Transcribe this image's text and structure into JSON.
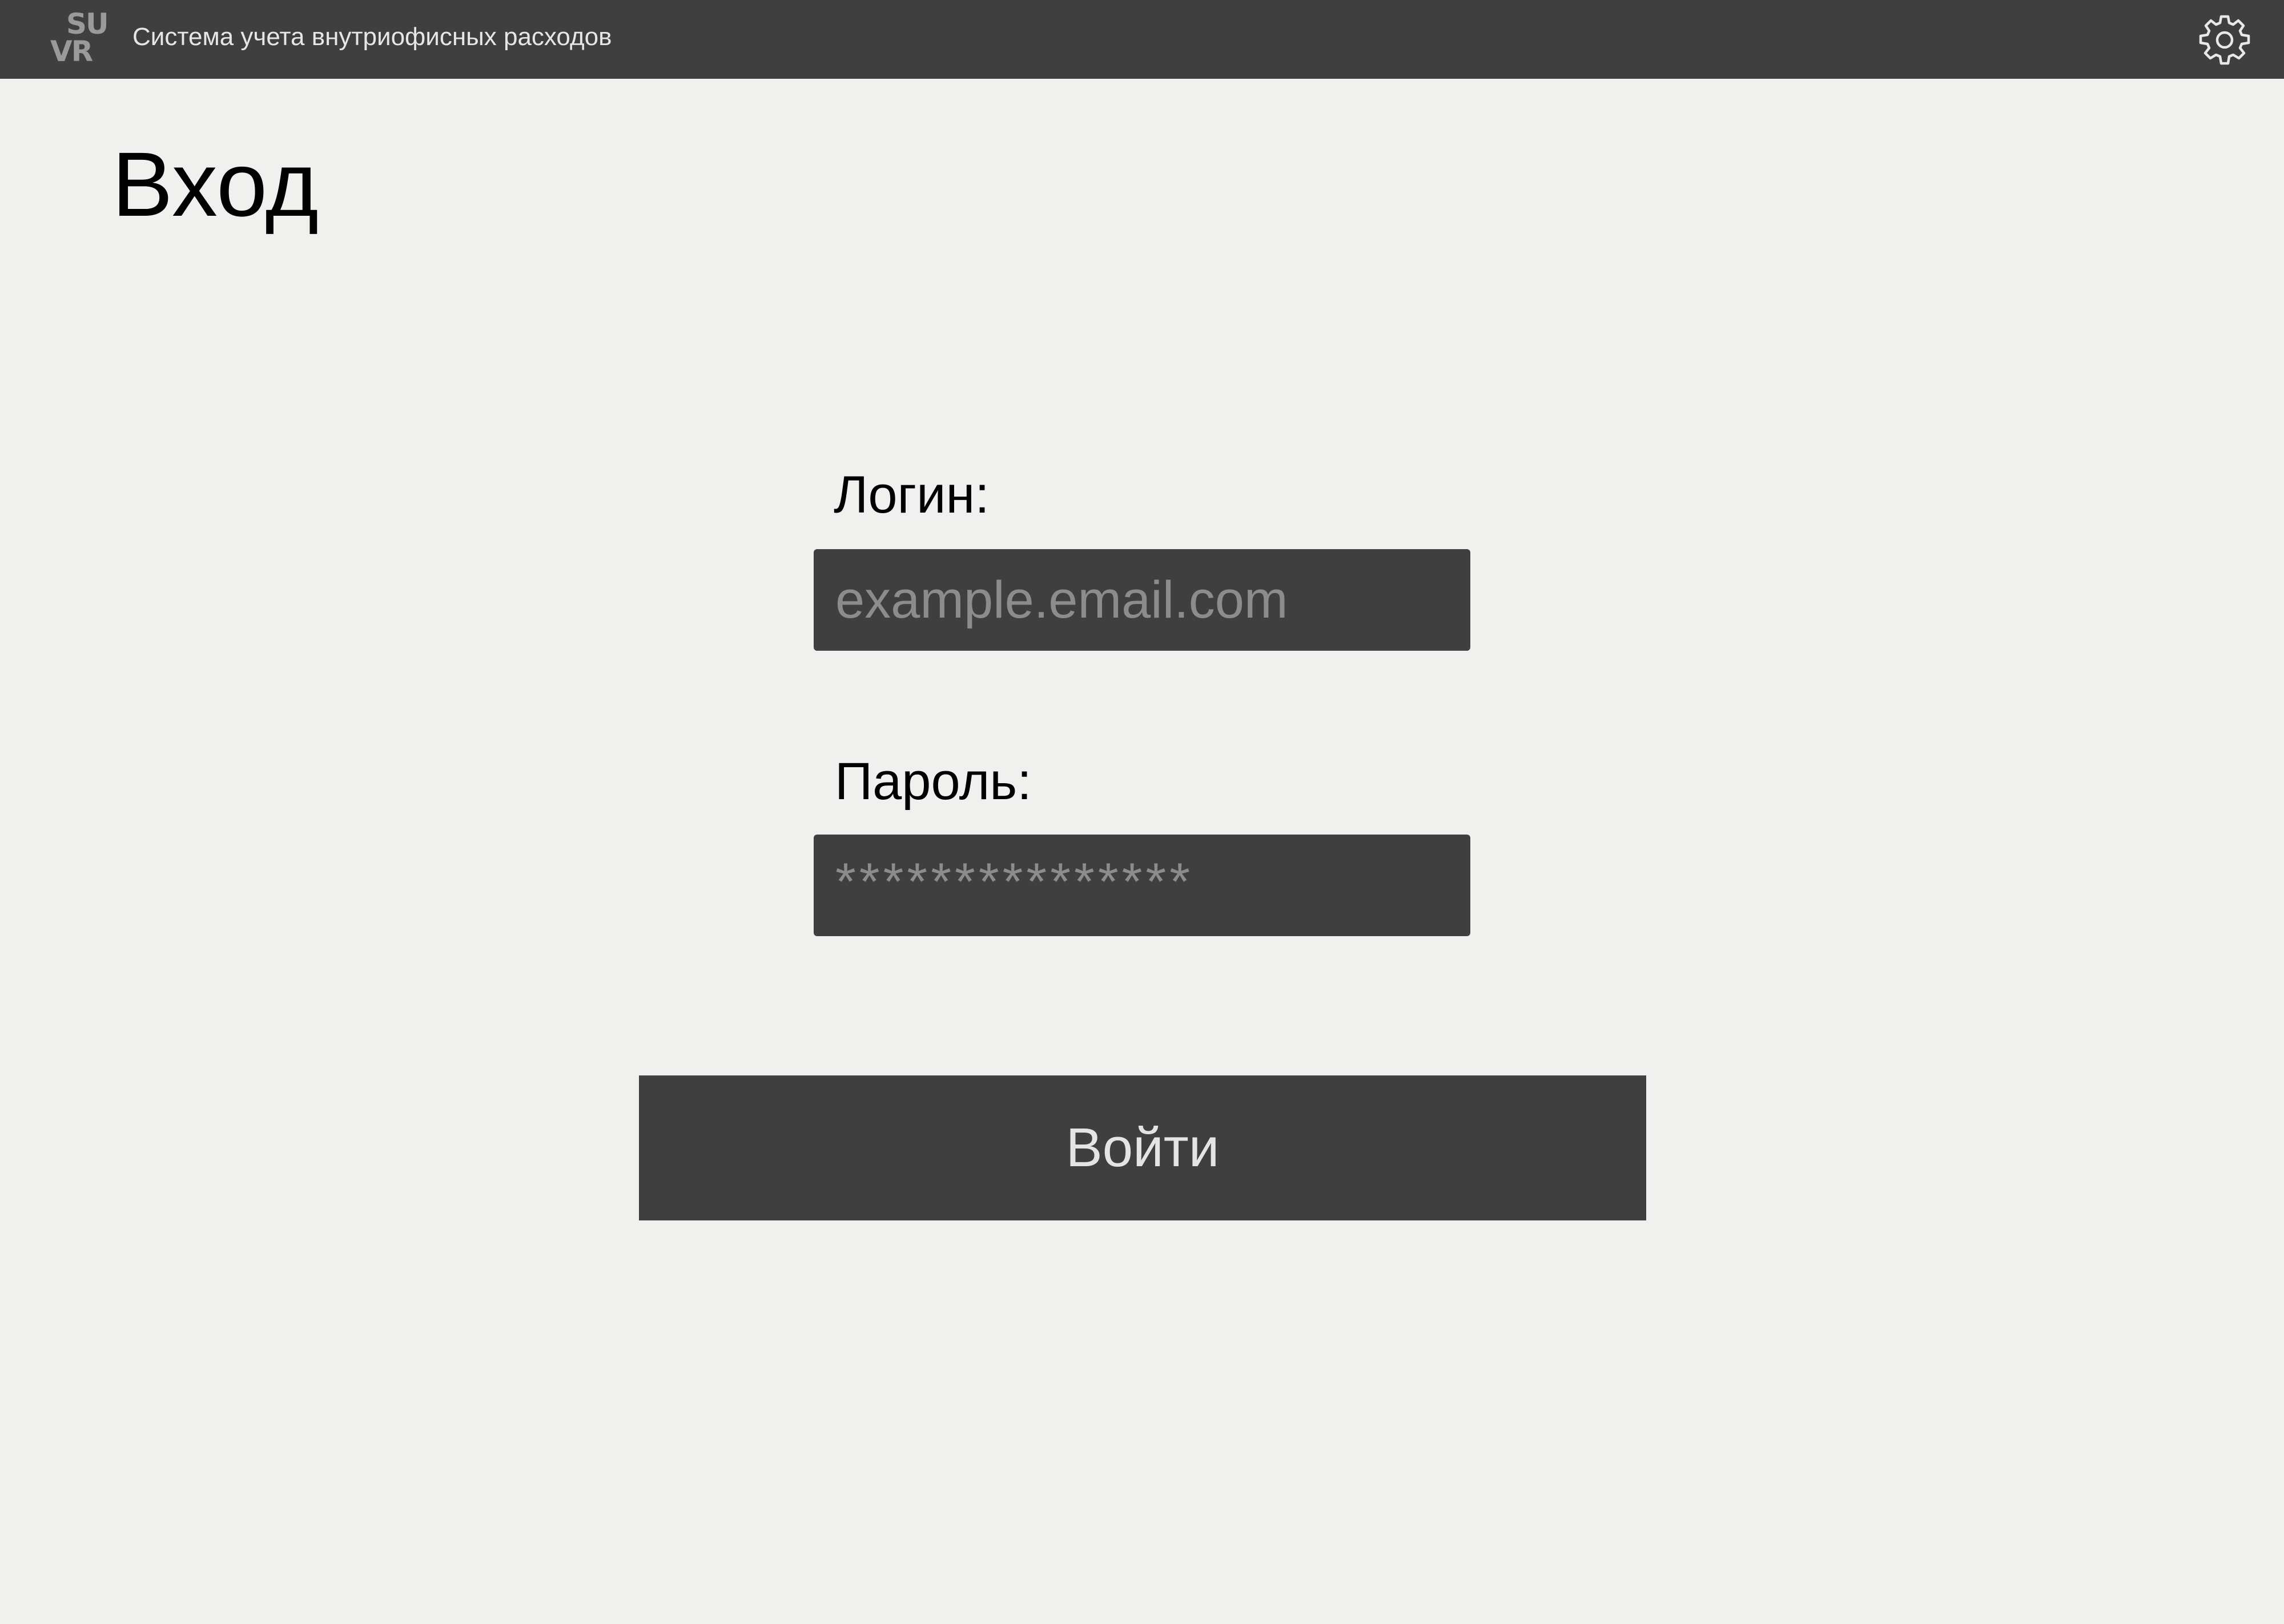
{
  "header": {
    "logo_line1": "SU",
    "logo_line2": "VR",
    "app_title": "Система учета внутриофисных расходов",
    "settings_icon": "gear-icon"
  },
  "main": {
    "heading": "Вход",
    "login": {
      "label": "Логин:",
      "placeholder": "example.email.com"
    },
    "password": {
      "label": "Пароль:",
      "placeholder": "***************"
    },
    "submit_label": "Войти"
  },
  "colors": {
    "background": "#f0f0ee",
    "bar": "#3f3f3f",
    "placeholder": "#8c8c8c"
  }
}
